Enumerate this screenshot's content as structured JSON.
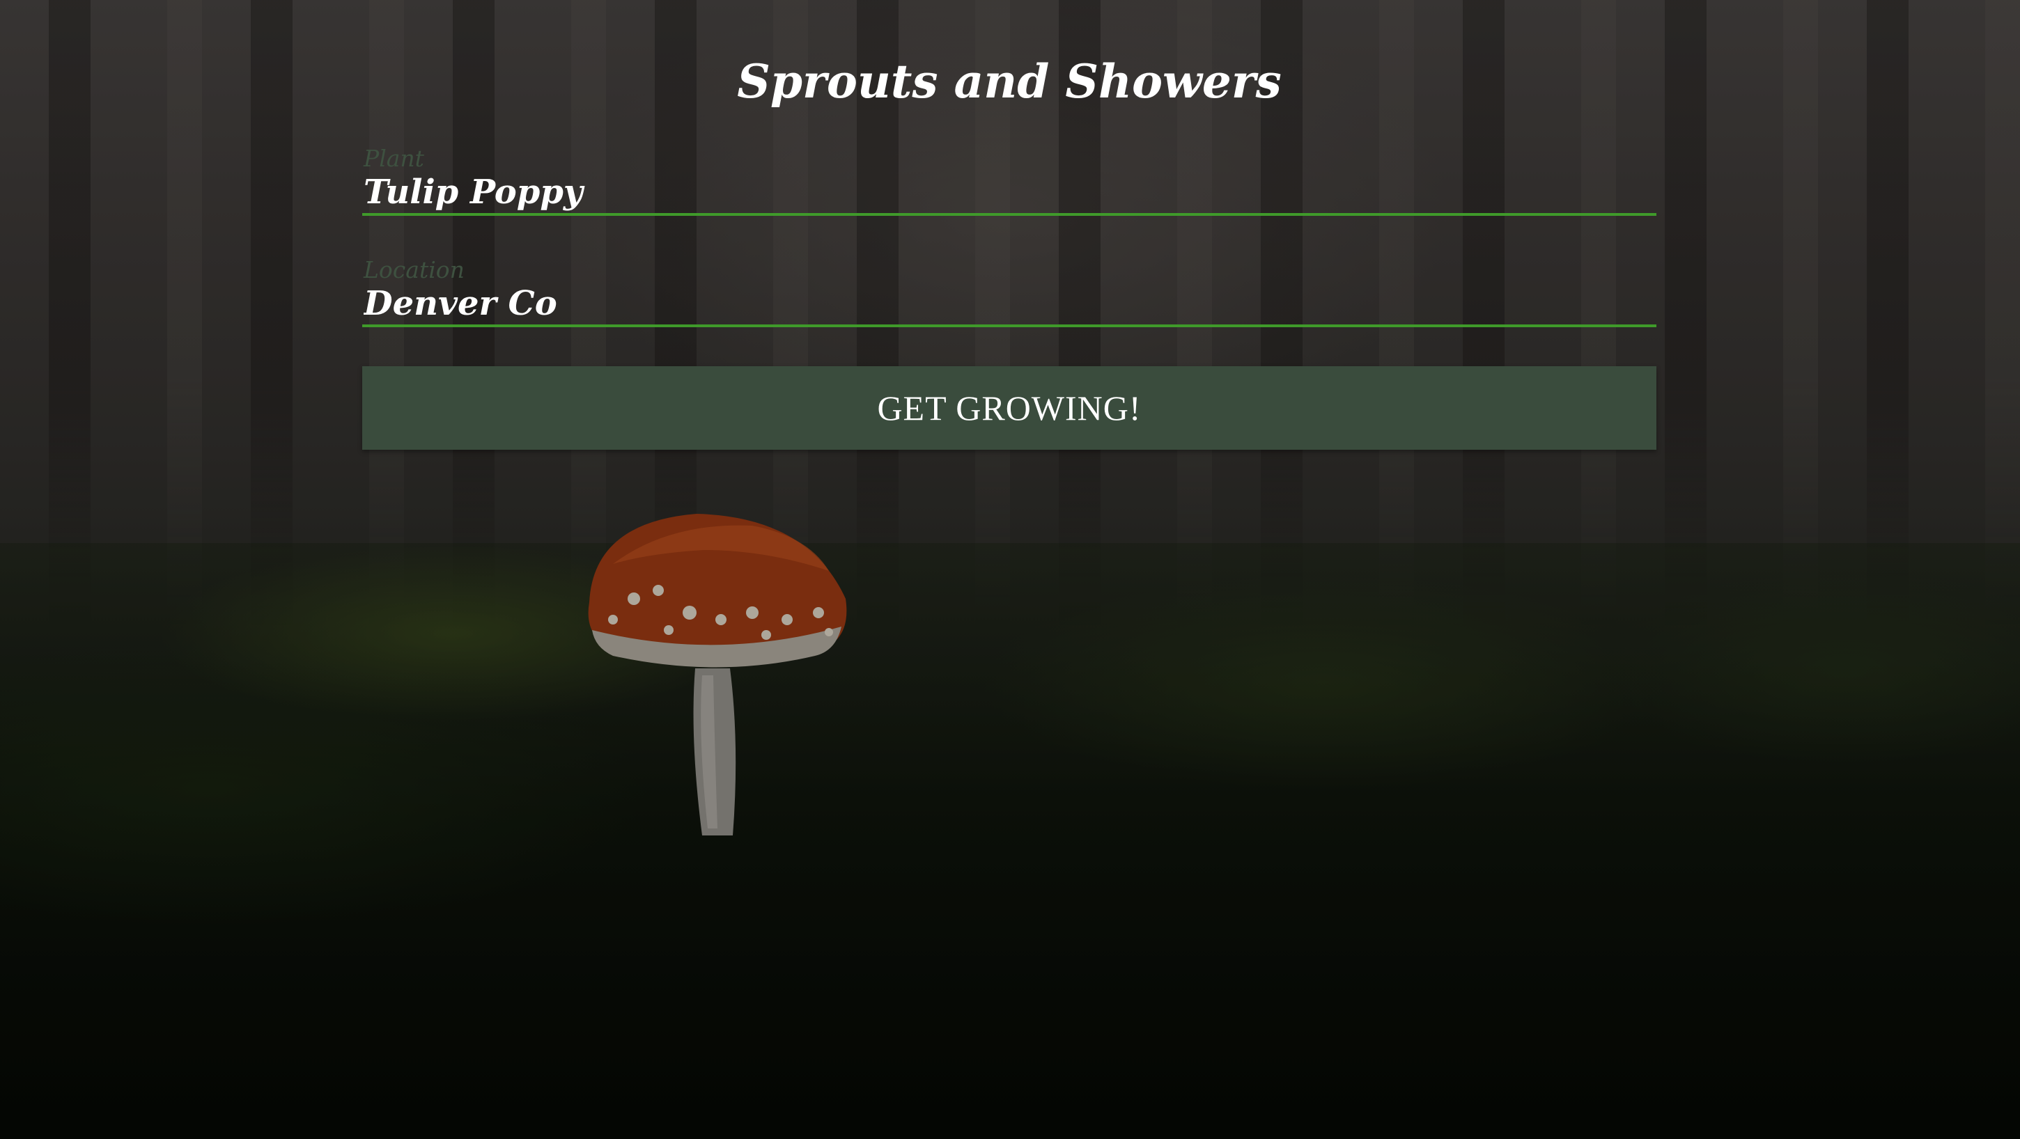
{
  "app": {
    "title": "Sprouts and Showers"
  },
  "form": {
    "plant": {
      "label": "Plant",
      "value": "Tulip Poppy"
    },
    "location": {
      "label": "Location",
      "value": "Denver Co"
    },
    "submit_label": "GET GROWING!"
  },
  "colors": {
    "underline": "#3f9a2a",
    "button_bg": "#3a4c3d",
    "label": "#3e5140"
  },
  "background": {
    "icon": "forest-mushroom-photo"
  }
}
